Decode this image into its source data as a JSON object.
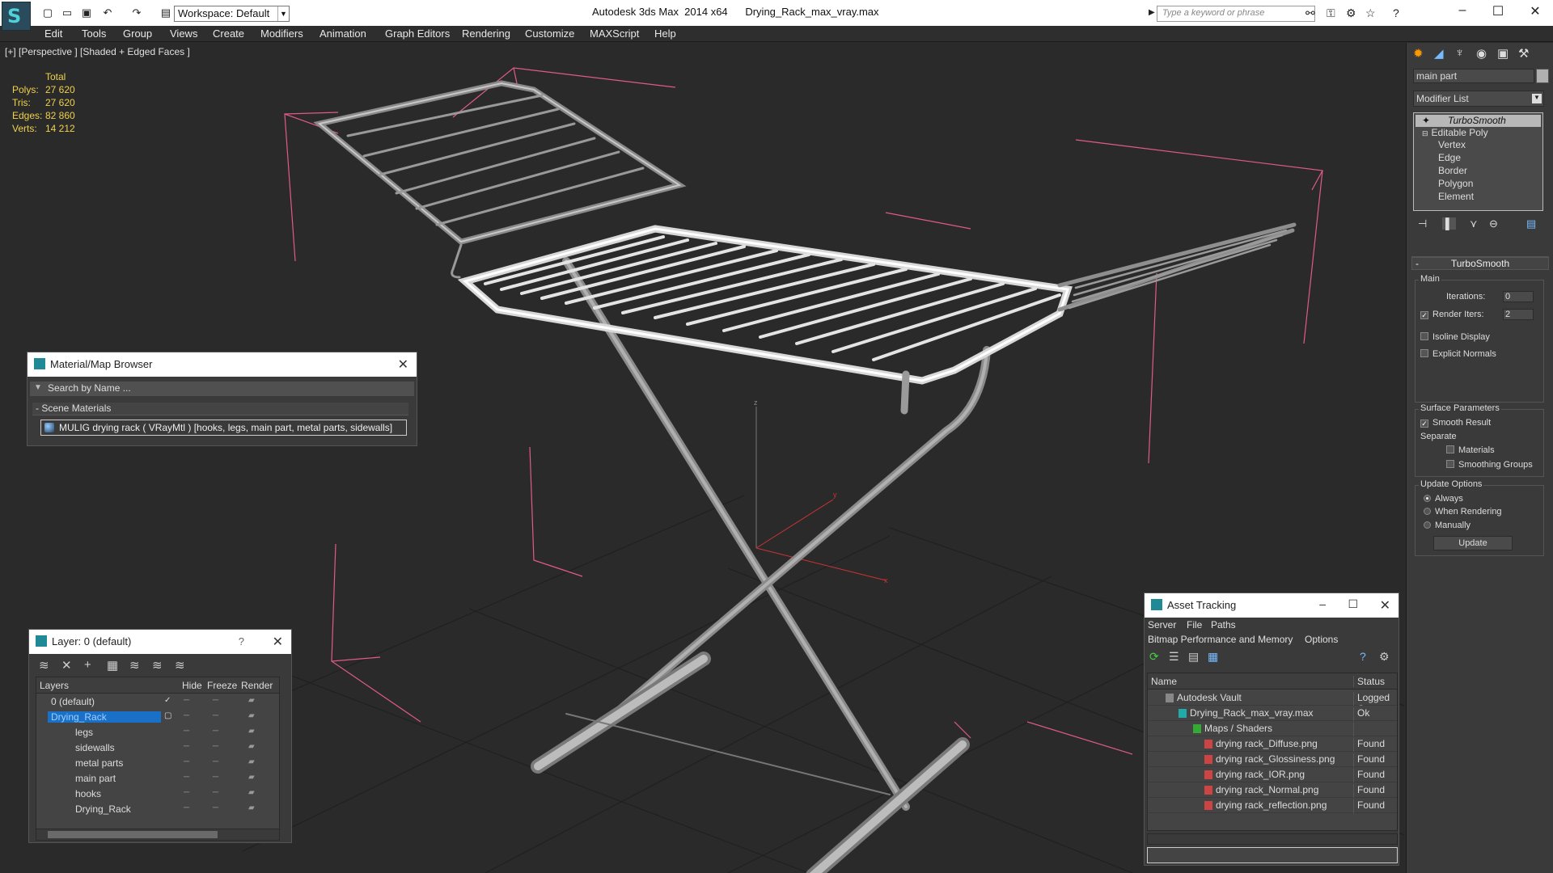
{
  "title_bar": {
    "app": "Autodesk 3ds Max  2014 x64",
    "file": "Drying_Rack_max_vray.max",
    "workspace": "Workspace: Default",
    "search_placeholder": "Type a keyword or phrase"
  },
  "menu": [
    "Edit",
    "Tools",
    "Group",
    "Views",
    "Create",
    "Modifiers",
    "Animation",
    "Graph Editors",
    "Rendering",
    "Customize",
    "MAXScript",
    "Help"
  ],
  "viewport": {
    "label": "[+] [Perspective ] [Shaded + Edged Faces ]",
    "stats": {
      "header": "Total",
      "rows": [
        {
          "label": "Polys:",
          "value": "27 620"
        },
        {
          "label": "Tris:",
          "value": "27 620"
        },
        {
          "label": "Edges:",
          "value": "82 860"
        },
        {
          "label": "Verts:",
          "value": "14 212"
        }
      ]
    },
    "axis_label_y": "y",
    "axis_label_x": "x",
    "axis_label_z": "z"
  },
  "material_browser": {
    "title": "Material/Map Browser",
    "search_placeholder": "Search by Name ...",
    "group": "- Scene Materials",
    "item": "MULIG drying rack  ( VRayMtl ) [hooks, legs, main part, metal parts, sidewalls]"
  },
  "layers_panel": {
    "title": "Layer: 0 (default)",
    "help": "?",
    "columns": [
      "Layers",
      "Hide",
      "Freeze",
      "Render"
    ],
    "rows": [
      {
        "name": "0 (default)",
        "selected": false
      },
      {
        "name": "Drying_Rack",
        "selected": true
      },
      {
        "name": "legs",
        "selected": false
      },
      {
        "name": "sidewalls",
        "selected": false
      },
      {
        "name": "metal parts",
        "selected": false
      },
      {
        "name": "main part",
        "selected": false
      },
      {
        "name": "hooks",
        "selected": false
      },
      {
        "name": "Drying_Rack",
        "selected": false
      }
    ]
  },
  "asset_tracking": {
    "title": "Asset Tracking",
    "menu1": [
      "Server",
      "File",
      "Paths"
    ],
    "menu2": [
      "Bitmap Performance and Memory",
      "Options"
    ],
    "columns": [
      "Name",
      "Status"
    ],
    "rows": [
      {
        "name": "Autodesk Vault",
        "status": "Logged Out"
      },
      {
        "name": "Drying_Rack_max_vray.max",
        "status": "Ok"
      },
      {
        "name": "Maps / Shaders",
        "status": ""
      },
      {
        "name": "drying rack_Diffuse.png",
        "status": "Found"
      },
      {
        "name": "drying rack_Glossiness.png",
        "status": "Found"
      },
      {
        "name": "drying rack_IOR.png",
        "status": "Found"
      },
      {
        "name": "drying rack_Normal.png",
        "status": "Found"
      },
      {
        "name": "drying rack_reflection.png",
        "status": "Found"
      }
    ]
  },
  "command_panel": {
    "object_name": "main part",
    "modifier_list": "Modifier List",
    "stack": [
      "TurboSmooth",
      "Editable Poly",
      "Vertex",
      "Edge",
      "Border",
      "Polygon",
      "Element"
    ],
    "rollout_title": "TurboSmooth",
    "main_group": "Main",
    "iterations_label": "Iterations:",
    "iterations_value": "0",
    "render_iters_label": "Render Iters:",
    "render_iters_value": "2",
    "render_iters_checked": true,
    "isoline": "Isoline Display",
    "explicit_normals": "Explicit Normals",
    "surface_group": "Surface Parameters",
    "smooth_result": "Smooth Result",
    "separate_label": "Separate",
    "materials": "Materials",
    "smoothing_groups": "Smoothing Groups",
    "update_group": "Update Options",
    "always": "Always",
    "when_rendering": "When Rendering",
    "manually": "Manually",
    "update_button": "Update"
  },
  "colors": {
    "stats": "#f0d24a",
    "bbox": "#e05a8a",
    "selection": "#1a6fc7"
  }
}
